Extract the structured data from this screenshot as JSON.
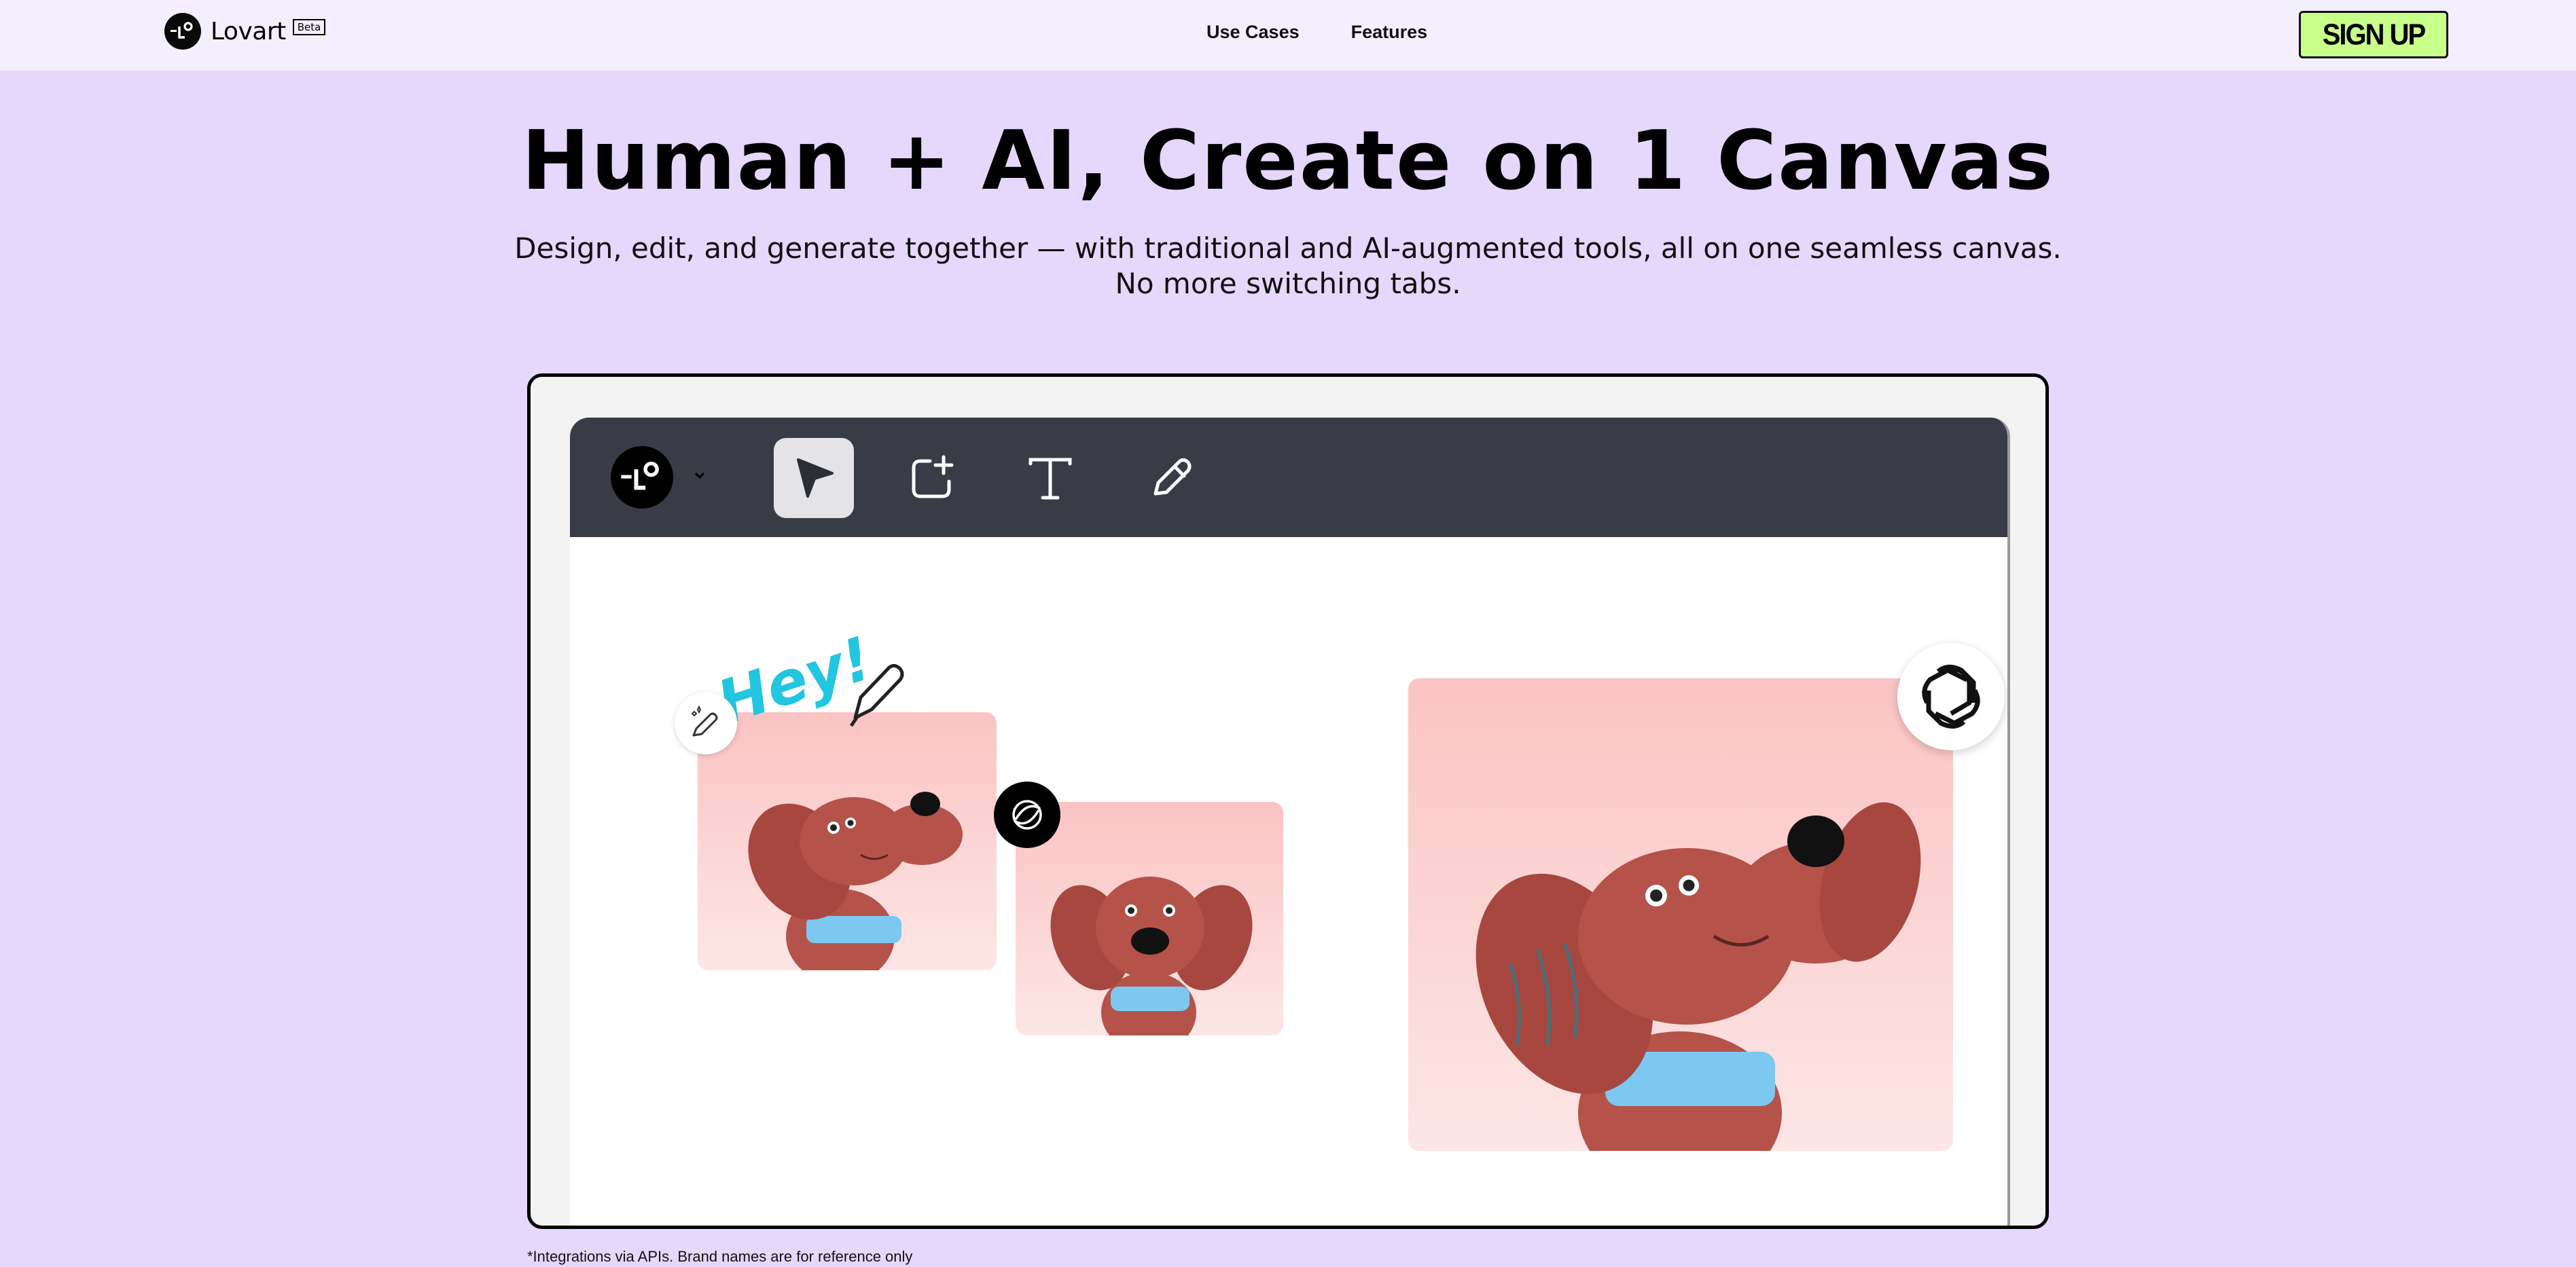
{
  "header": {
    "brand_name": "Lovart",
    "brand_badge": "Beta",
    "nav": [
      {
        "label": "Use Cases"
      },
      {
        "label": "Features"
      }
    ],
    "signup_label": "SIGN UP"
  },
  "hero": {
    "title": "Human + AI, Create on 1 Canvas",
    "subtitle_line1": "Design, edit, and generate together — with traditional and AI-augmented tools, all on one seamless canvas.",
    "subtitle_line2": "No more switching tabs."
  },
  "canvas": {
    "toolbar_tools": [
      {
        "name": "select-tool",
        "icon": "cursor-arrow-icon",
        "active": true
      },
      {
        "name": "frame-tool",
        "icon": "add-frame-icon",
        "active": false
      },
      {
        "name": "text-tool",
        "icon": "text-T-icon",
        "active": false
      },
      {
        "name": "pen-tool",
        "icon": "pencil-icon",
        "active": false
      }
    ],
    "sketch_text": "Hey!"
  },
  "colors": {
    "page_bg": "#e6d7fd",
    "header_bg": "#f4effe",
    "signup_bg": "#c8ff8a",
    "toolbar_bg": "#393c46",
    "image_pink": "#fbc8c8",
    "dog_red": "#b5524a",
    "collar_blue": "#7cc8f0",
    "sketch_cyan": "#22c6e0"
  },
  "footnote": "*Integrations via APIs. Brand names are for reference only"
}
